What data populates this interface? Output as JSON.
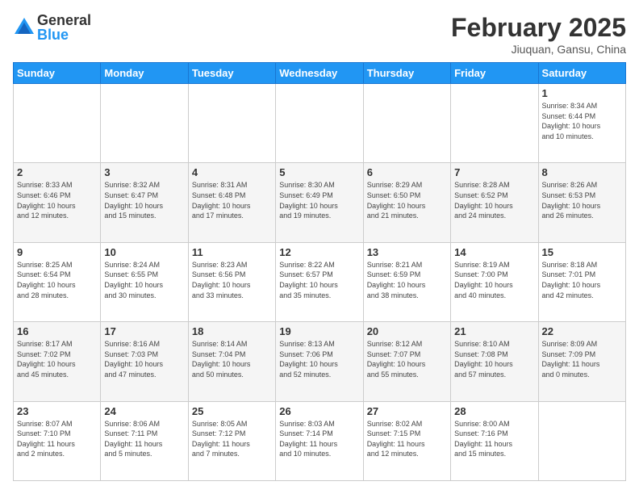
{
  "logo": {
    "general": "General",
    "blue": "Blue"
  },
  "header": {
    "month": "February 2025",
    "location": "Jiuquan, Gansu, China"
  },
  "days_of_week": [
    "Sunday",
    "Monday",
    "Tuesday",
    "Wednesday",
    "Thursday",
    "Friday",
    "Saturday"
  ],
  "weeks": [
    [
      {
        "day": "",
        "info": ""
      },
      {
        "day": "",
        "info": ""
      },
      {
        "day": "",
        "info": ""
      },
      {
        "day": "",
        "info": ""
      },
      {
        "day": "",
        "info": ""
      },
      {
        "day": "",
        "info": ""
      },
      {
        "day": "1",
        "info": "Sunrise: 8:34 AM\nSunset: 6:44 PM\nDaylight: 10 hours\nand 10 minutes."
      }
    ],
    [
      {
        "day": "2",
        "info": "Sunrise: 8:33 AM\nSunset: 6:46 PM\nDaylight: 10 hours\nand 12 minutes."
      },
      {
        "day": "3",
        "info": "Sunrise: 8:32 AM\nSunset: 6:47 PM\nDaylight: 10 hours\nand 15 minutes."
      },
      {
        "day": "4",
        "info": "Sunrise: 8:31 AM\nSunset: 6:48 PM\nDaylight: 10 hours\nand 17 minutes."
      },
      {
        "day": "5",
        "info": "Sunrise: 8:30 AM\nSunset: 6:49 PM\nDaylight: 10 hours\nand 19 minutes."
      },
      {
        "day": "6",
        "info": "Sunrise: 8:29 AM\nSunset: 6:50 PM\nDaylight: 10 hours\nand 21 minutes."
      },
      {
        "day": "7",
        "info": "Sunrise: 8:28 AM\nSunset: 6:52 PM\nDaylight: 10 hours\nand 24 minutes."
      },
      {
        "day": "8",
        "info": "Sunrise: 8:26 AM\nSunset: 6:53 PM\nDaylight: 10 hours\nand 26 minutes."
      }
    ],
    [
      {
        "day": "9",
        "info": "Sunrise: 8:25 AM\nSunset: 6:54 PM\nDaylight: 10 hours\nand 28 minutes."
      },
      {
        "day": "10",
        "info": "Sunrise: 8:24 AM\nSunset: 6:55 PM\nDaylight: 10 hours\nand 30 minutes."
      },
      {
        "day": "11",
        "info": "Sunrise: 8:23 AM\nSunset: 6:56 PM\nDaylight: 10 hours\nand 33 minutes."
      },
      {
        "day": "12",
        "info": "Sunrise: 8:22 AM\nSunset: 6:57 PM\nDaylight: 10 hours\nand 35 minutes."
      },
      {
        "day": "13",
        "info": "Sunrise: 8:21 AM\nSunset: 6:59 PM\nDaylight: 10 hours\nand 38 minutes."
      },
      {
        "day": "14",
        "info": "Sunrise: 8:19 AM\nSunset: 7:00 PM\nDaylight: 10 hours\nand 40 minutes."
      },
      {
        "day": "15",
        "info": "Sunrise: 8:18 AM\nSunset: 7:01 PM\nDaylight: 10 hours\nand 42 minutes."
      }
    ],
    [
      {
        "day": "16",
        "info": "Sunrise: 8:17 AM\nSunset: 7:02 PM\nDaylight: 10 hours\nand 45 minutes."
      },
      {
        "day": "17",
        "info": "Sunrise: 8:16 AM\nSunset: 7:03 PM\nDaylight: 10 hours\nand 47 minutes."
      },
      {
        "day": "18",
        "info": "Sunrise: 8:14 AM\nSunset: 7:04 PM\nDaylight: 10 hours\nand 50 minutes."
      },
      {
        "day": "19",
        "info": "Sunrise: 8:13 AM\nSunset: 7:06 PM\nDaylight: 10 hours\nand 52 minutes."
      },
      {
        "day": "20",
        "info": "Sunrise: 8:12 AM\nSunset: 7:07 PM\nDaylight: 10 hours\nand 55 minutes."
      },
      {
        "day": "21",
        "info": "Sunrise: 8:10 AM\nSunset: 7:08 PM\nDaylight: 10 hours\nand 57 minutes."
      },
      {
        "day": "22",
        "info": "Sunrise: 8:09 AM\nSunset: 7:09 PM\nDaylight: 11 hours\nand 0 minutes."
      }
    ],
    [
      {
        "day": "23",
        "info": "Sunrise: 8:07 AM\nSunset: 7:10 PM\nDaylight: 11 hours\nand 2 minutes."
      },
      {
        "day": "24",
        "info": "Sunrise: 8:06 AM\nSunset: 7:11 PM\nDaylight: 11 hours\nand 5 minutes."
      },
      {
        "day": "25",
        "info": "Sunrise: 8:05 AM\nSunset: 7:12 PM\nDaylight: 11 hours\nand 7 minutes."
      },
      {
        "day": "26",
        "info": "Sunrise: 8:03 AM\nSunset: 7:14 PM\nDaylight: 11 hours\nand 10 minutes."
      },
      {
        "day": "27",
        "info": "Sunrise: 8:02 AM\nSunset: 7:15 PM\nDaylight: 11 hours\nand 12 minutes."
      },
      {
        "day": "28",
        "info": "Sunrise: 8:00 AM\nSunset: 7:16 PM\nDaylight: 11 hours\nand 15 minutes."
      },
      {
        "day": "",
        "info": ""
      }
    ]
  ]
}
